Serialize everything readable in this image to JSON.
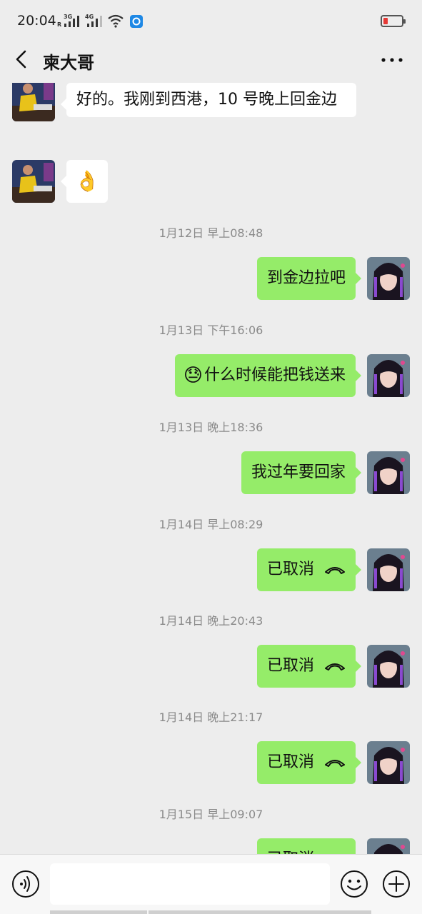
{
  "status_bar": {
    "time": "20:04",
    "signal1_label": "3G",
    "signal1_sub": "R",
    "signal2_label": "4G",
    "battery_color": "#e53935"
  },
  "nav": {
    "title": "柬大哥"
  },
  "messages": [
    {
      "type": "incoming",
      "text": "好的。我刚到西港，10 号晚上回金边"
    },
    {
      "type": "incoming",
      "emoji": "👌"
    },
    {
      "type": "timestamp",
      "text": "1月12日 早上08:48"
    },
    {
      "type": "outgoing",
      "text": "到金边拉吧"
    },
    {
      "type": "timestamp",
      "text": "1月13日 下午16:06"
    },
    {
      "type": "outgoing",
      "emoji": "😓",
      "text": "什么时候能把钱送来"
    },
    {
      "type": "timestamp",
      "text": "1月13日 晚上18:36"
    },
    {
      "type": "outgoing",
      "text": "我过年要回家"
    },
    {
      "type": "timestamp",
      "text": "1月14日 早上08:29"
    },
    {
      "type": "outgoing",
      "text": "已取消",
      "icon": "hangup-icon"
    },
    {
      "type": "timestamp",
      "text": "1月14日 晚上20:43"
    },
    {
      "type": "outgoing",
      "text": "已取消",
      "icon": "hangup-icon"
    },
    {
      "type": "timestamp",
      "text": "1月14日 晚上21:17"
    },
    {
      "type": "outgoing",
      "text": "已取消",
      "icon": "hangup-icon"
    },
    {
      "type": "timestamp",
      "text": "1月15日 早上09:07"
    },
    {
      "type": "outgoing",
      "text": "已取消",
      "icon": "hangup-icon"
    }
  ],
  "colors": {
    "background": "#ededed",
    "outgoing_bubble": "#95ec69",
    "incoming_bubble": "#ffffff",
    "timestamp_text": "#8a8a8a"
  },
  "bottom_bar": {
    "input_value": "",
    "voice_icon": "voice-icon",
    "emoji_icon": "emoji-icon",
    "plus_icon": "plus-icon"
  }
}
